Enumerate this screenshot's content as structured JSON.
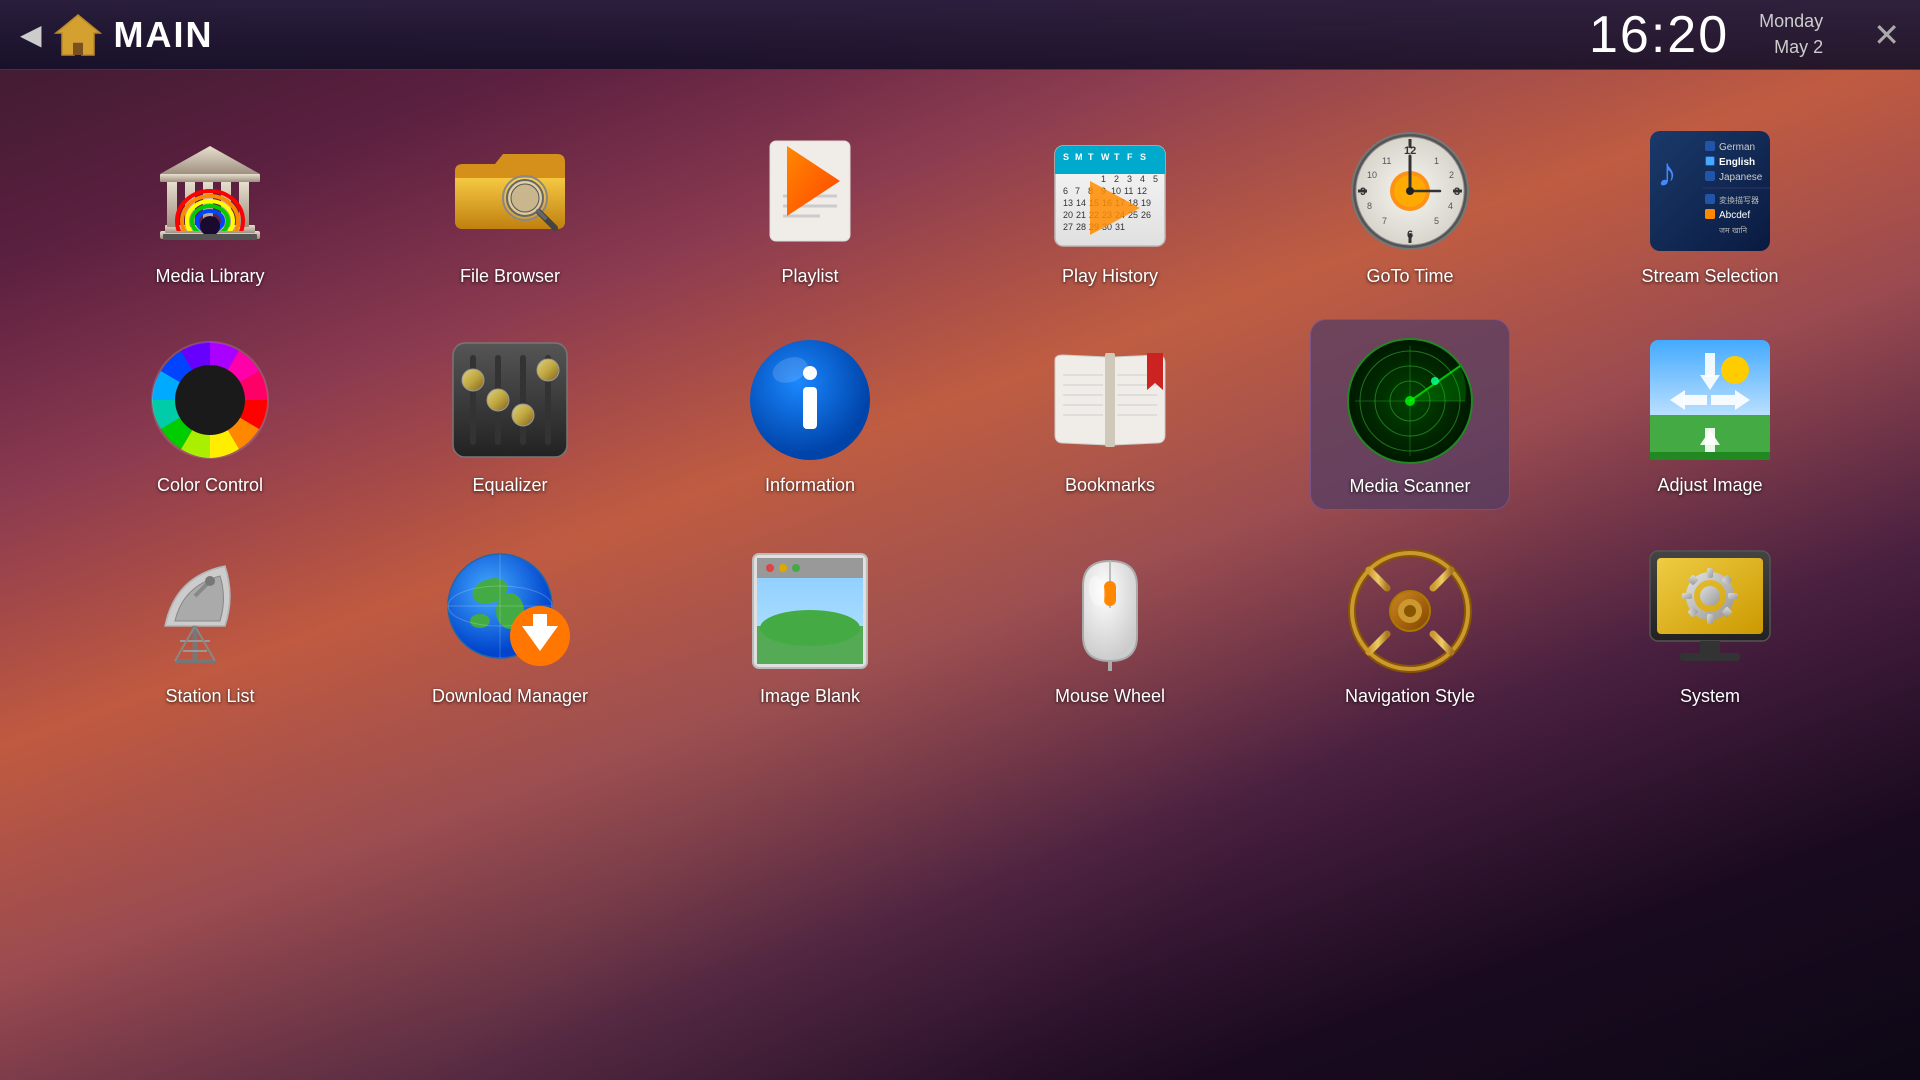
{
  "header": {
    "title": "MAIN",
    "time": "16:20",
    "day": "Monday",
    "date": "May 2",
    "back_label": "◀",
    "close_label": "✕"
  },
  "grid": {
    "rows": [
      {
        "items": [
          {
            "id": "media-library",
            "label": "Media Library"
          },
          {
            "id": "file-browser",
            "label": "File Browser"
          },
          {
            "id": "playlist",
            "label": "Playlist"
          },
          {
            "id": "play-history",
            "label": "Play History"
          },
          {
            "id": "goto-time",
            "label": "GoTo Time"
          },
          {
            "id": "stream-selection",
            "label": "Stream Selection"
          }
        ]
      },
      {
        "items": [
          {
            "id": "color-control",
            "label": "Color Control"
          },
          {
            "id": "equalizer",
            "label": "Equalizer"
          },
          {
            "id": "information",
            "label": "Information"
          },
          {
            "id": "bookmarks",
            "label": "Bookmarks"
          },
          {
            "id": "media-scanner",
            "label": "Media Scanner",
            "active": true
          },
          {
            "id": "adjust-image",
            "label": "Adjust Image"
          }
        ]
      },
      {
        "items": [
          {
            "id": "station-list",
            "label": "Station List"
          },
          {
            "id": "download-manager",
            "label": "Download Manager"
          },
          {
            "id": "image-blank",
            "label": "Image Blank"
          },
          {
            "id": "mouse-wheel",
            "label": "Mouse Wheel"
          },
          {
            "id": "navigation-style",
            "label": "Navigation Style"
          },
          {
            "id": "system",
            "label": "System"
          }
        ]
      }
    ]
  }
}
